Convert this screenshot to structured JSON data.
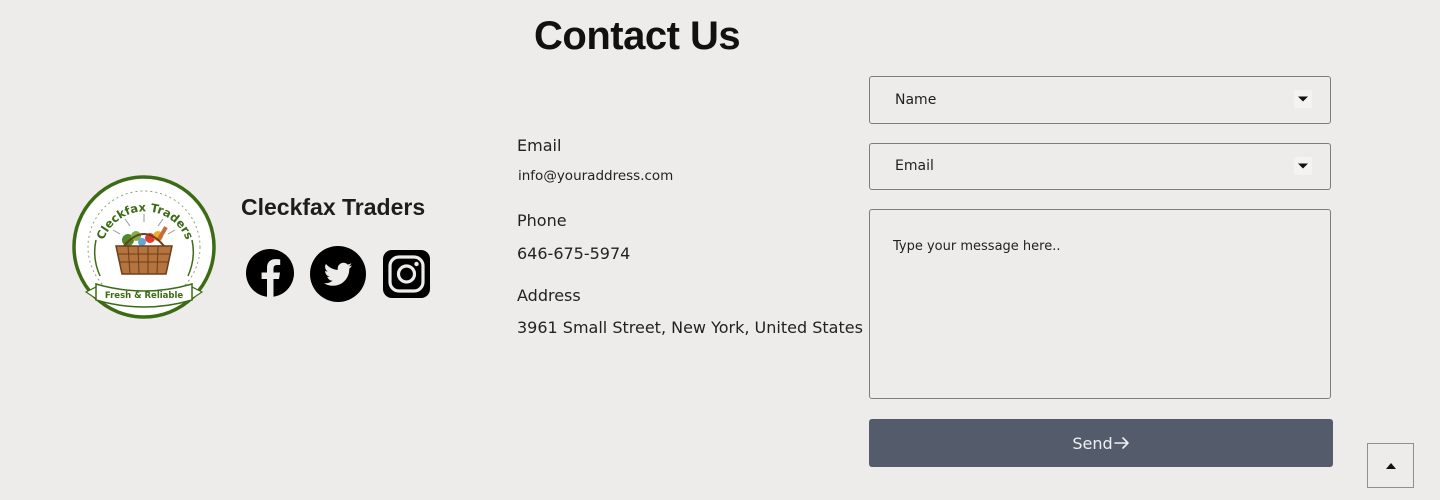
{
  "page": {
    "title": "Contact Us"
  },
  "brand": {
    "logo_arc_text": "Cleckfax Traders",
    "logo_ribbon_text": "Fresh & Reliable",
    "name": "Cleckfax Traders",
    "social": [
      {
        "icon": "facebook-icon"
      },
      {
        "icon": "twitter-icon"
      },
      {
        "icon": "instagram-icon"
      }
    ]
  },
  "contact": {
    "email_label": "Email",
    "email_value": "info@youraddress.com",
    "phone_label": "Phone",
    "phone_value": "646-675-5974",
    "address_label": "Address",
    "address_value": "3961 Small Street, New York, United States"
  },
  "form": {
    "name_placeholder": "Name",
    "email_placeholder": "Email",
    "message_placeholder": "Type your message here..",
    "send_label": "Send"
  },
  "colors": {
    "background": "#eeecea",
    "button": "#545b6b",
    "logo_green": "#3b6b14"
  }
}
